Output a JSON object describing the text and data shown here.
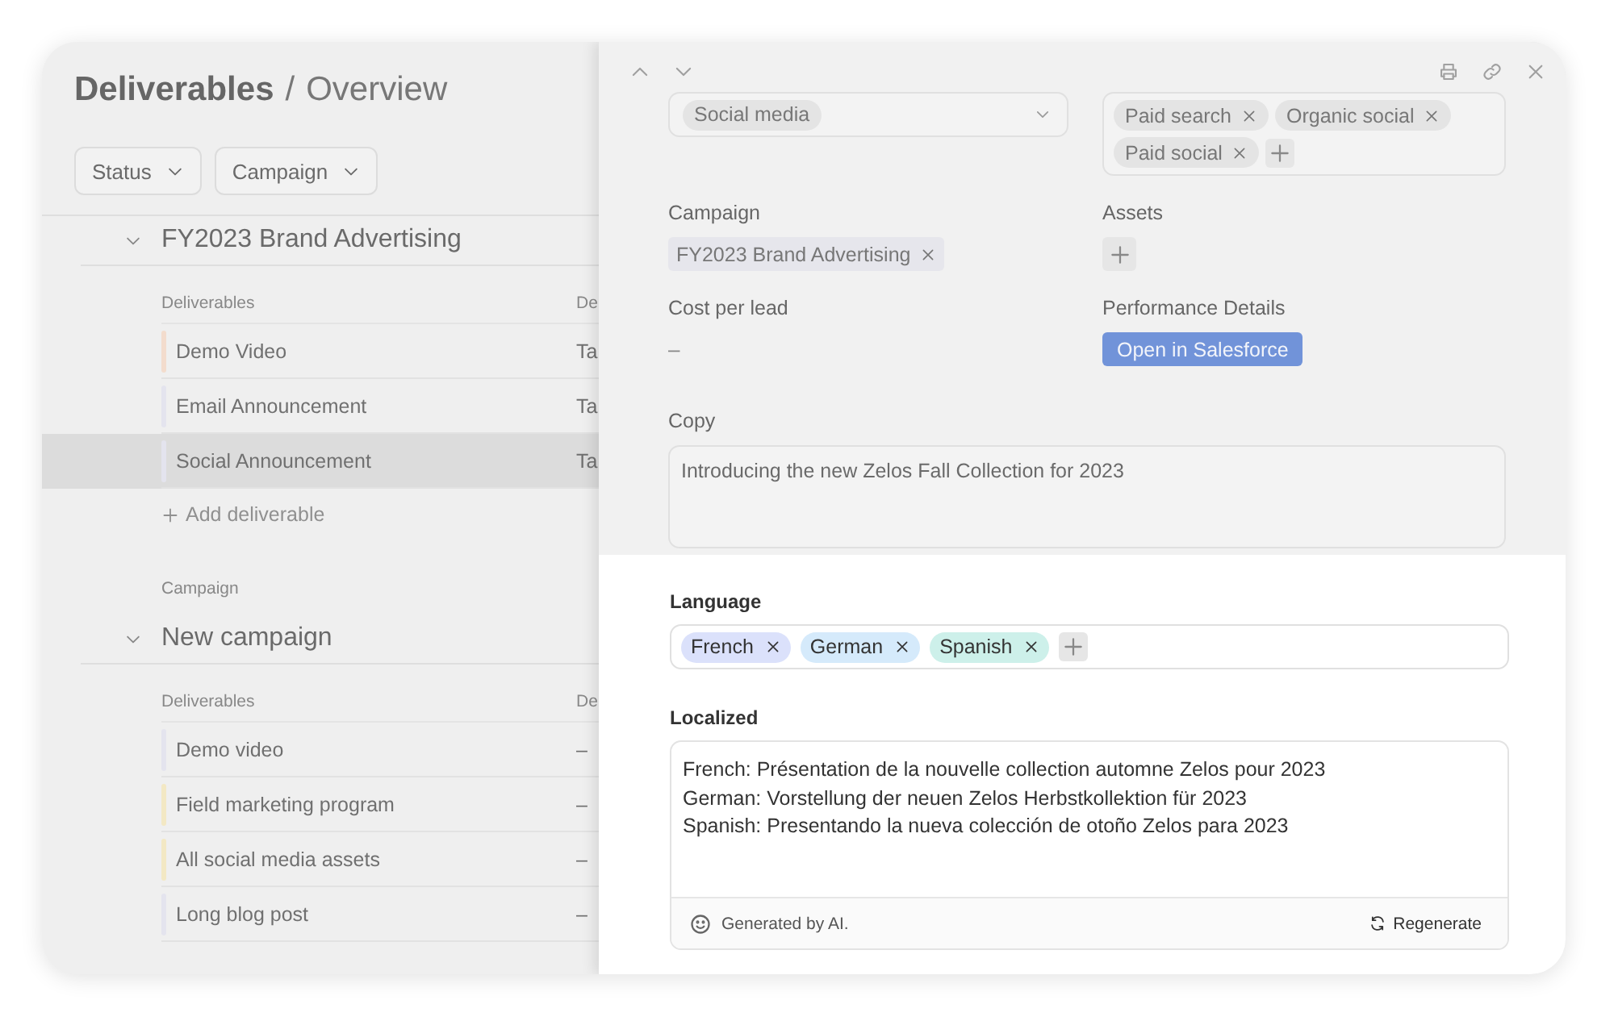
{
  "page": {
    "title": "Deliverables",
    "separator": "/",
    "subtitle": "Overview"
  },
  "filters": [
    {
      "label": "Status"
    },
    {
      "label": "Campaign"
    }
  ],
  "groups": [
    {
      "name": "FY2023 Brand Advertising",
      "expanded": true,
      "columns": [
        "Deliverables",
        "De"
      ],
      "add_label": "Add deliverable",
      "rows": [
        {
          "name": "Demo Video",
          "column_2": "Ta",
          "color": "#f3dccd",
          "selected": false
        },
        {
          "name": "Email Announcement",
          "column_2": "Ta",
          "color": "#e4e4ee",
          "selected": false
        },
        {
          "name": "Social Announcement",
          "column_2": "Ta",
          "color": "#e4e4ee",
          "selected": true
        }
      ]
    },
    {
      "caption": "Campaign",
      "name": "New campaign",
      "expanded": true,
      "columns": [
        "Deliverables",
        "De"
      ],
      "rows": [
        {
          "name": "Demo video",
          "column_2": "–",
          "color": "#e4e4ee",
          "selected": false
        },
        {
          "name": "Field marketing program",
          "column_2": "–",
          "color": "#f3e8c4",
          "selected": false
        },
        {
          "name": "All social media assets",
          "column_2": "–",
          "color": "#f3e8c4",
          "selected": false
        },
        {
          "name": "Long blog post",
          "column_2": "–",
          "color": "#e4e4ee",
          "selected": false
        }
      ]
    }
  ],
  "detail": {
    "channel_select": {
      "value": "Social media"
    },
    "channel_tags": [
      "Paid search",
      "Organic social",
      "Paid social"
    ],
    "campaign": {
      "label": "Campaign",
      "tags": [
        "FY2023 Brand Advertising"
      ]
    },
    "assets": {
      "label": "Assets"
    },
    "cost_per_lead": {
      "label": "Cost per lead",
      "value": "–"
    },
    "performance": {
      "label": "Performance Details",
      "button": "Open in Salesforce"
    },
    "copy": {
      "label": "Copy",
      "value": "Introducing the new Zelos Fall Collection for 2023"
    }
  },
  "localization": {
    "language": {
      "label": "Language",
      "tags": [
        {
          "label": "French",
          "color": "#dbe1fb"
        },
        {
          "label": "German",
          "color": "#d5eafb"
        },
        {
          "label": "Spanish",
          "color": "#cdf0ea"
        }
      ]
    },
    "localized": {
      "label": "Localized",
      "lines": [
        "French: Présentation de la nouvelle collection automne Zelos pour 2023",
        "German: Vorstellung der neuen Zelos Herbstkollektion für 2023",
        "Spanish: Presentando la nueva colección de otoño Zelos para 2023"
      ],
      "footnote": "Generated by AI.",
      "action": "Regenerate"
    }
  }
}
